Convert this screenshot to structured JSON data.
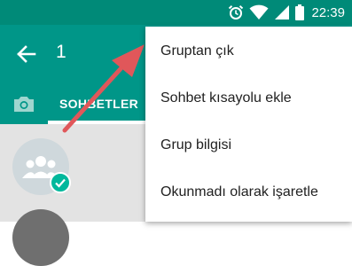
{
  "status_bar": {
    "time": "22:39",
    "icons": [
      "alarm-icon",
      "wifi-icon",
      "signal-icon",
      "battery-icon"
    ]
  },
  "app_bar": {
    "selected_count": "1",
    "back_icon": "arrow-left-icon"
  },
  "tabs": {
    "camera_icon": "camera-icon",
    "chats_label": "SOHBETLER"
  },
  "chat_list": {
    "avatar_icon": "group-icon",
    "badge_icon": "check-icon"
  },
  "overflow_menu": {
    "items": [
      {
        "label": "Gruptan çık"
      },
      {
        "label": "Sohbet kısayolu ekle"
      },
      {
        "label": "Grup bilgisi"
      },
      {
        "label": "Okunmadı olarak işaretle"
      }
    ]
  },
  "colors": {
    "primary": "#009688",
    "status_bar": "#008a78",
    "accent": "#00b89c",
    "annotation_arrow": "#e0575a"
  }
}
